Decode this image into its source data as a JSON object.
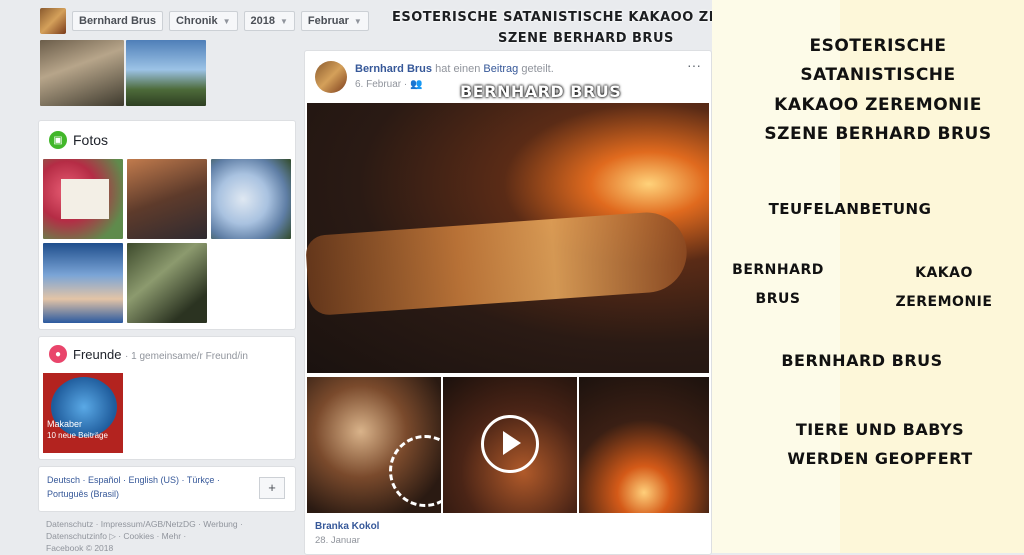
{
  "topbar": {
    "name": "Bernhard Brus",
    "tab": "Chronik",
    "year": "2018",
    "month": "Februar"
  },
  "overlay": {
    "header_line1": "ESOTERISCHE SATANISTISCHE KAKAOO ZEREMONIE",
    "header_line2": "SZENE BERHARD BRUS",
    "post_caption": "BERNHARD BRUS"
  },
  "photos_section": {
    "title": "Fotos"
  },
  "friends_section": {
    "title": "Freunde",
    "mutual": "· 1 gemeinsame/r Freund/in",
    "friend_name": "Makaber",
    "friend_sub": "10 neue Beiträge"
  },
  "languages": {
    "line1": "Deutsch · Español · English (US) · Türkçe ·",
    "line2": "Português (Brasil)",
    "add": "+"
  },
  "footer": {
    "line1": "Datenschutz · Impressum/AGB/NetzDG · Werbung ·",
    "line2": "Datenschutzinfo ▷ · Cookies · Mehr ·",
    "line3": "Facebook © 2018"
  },
  "post": {
    "author": "Bernhard Brus",
    "action": "hat einen",
    "object": "Beitrag",
    "action_end": "geteilt.",
    "date": "6. Februar ·",
    "more": "···",
    "shared_author": "Branka Kokol",
    "shared_date": "28. Januar"
  },
  "right_panel": {
    "t1": "ESOTERISCHE",
    "t2": "SATANISTISCHE",
    "t3": "KAKAOO ZEREMONIE",
    "t4": "SZENE BERHARD BRUS",
    "t5": "TEUFELANBETUNG",
    "t6a": "BERNHARD",
    "t6b": "BRUS",
    "t7a": "KAKAO",
    "t7b": "ZEREMONIE",
    "t8": "BERNHARD BRUS",
    "t9": "TIERE UND BABYS",
    "t10": "WERDEN GEOPFERT"
  },
  "colors": {
    "fb_blue": "#365899",
    "photos_icon": "#42b72a",
    "friends_icon": "#e9456b",
    "panel_bg": "#fdfbe8"
  }
}
